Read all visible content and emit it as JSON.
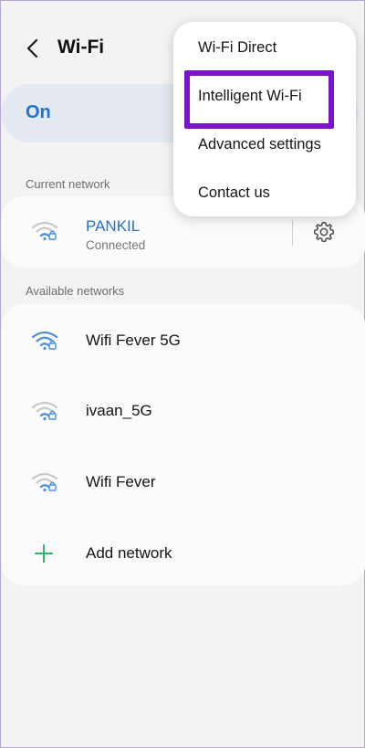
{
  "header": {
    "title": "Wi-Fi",
    "back_icon": "chevron-left-icon"
  },
  "master_toggle": {
    "label": "On",
    "state": "on",
    "accent": "#1f73cc"
  },
  "current_network": {
    "section_title": "Current network",
    "name": "PANKIL",
    "status": "Connected",
    "settings_icon": "gear-icon"
  },
  "available_networks": {
    "section_title": "Available networks",
    "items": [
      {
        "name": "Wifi Fever 5G",
        "signal": "strong",
        "secured": true
      },
      {
        "name": "ivaan_5G",
        "signal": "weak",
        "secured": true
      },
      {
        "name": "Wifi Fever",
        "signal": "weak",
        "secured": true
      }
    ],
    "add_label": "Add network"
  },
  "overflow_menu": {
    "items": [
      {
        "label": "Wi-Fi Direct"
      },
      {
        "label": "Intelligent Wi-Fi",
        "highlighted": true
      },
      {
        "label": "Advanced settings"
      },
      {
        "label": "Contact us"
      }
    ],
    "highlight_color": "#7b14c9"
  }
}
